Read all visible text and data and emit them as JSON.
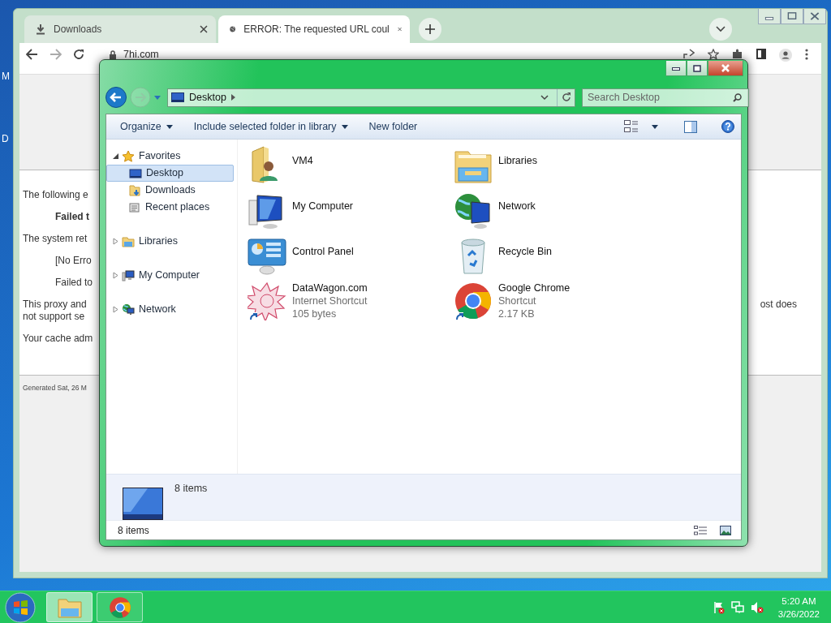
{
  "desktop": {
    "labels": [
      "M",
      "D"
    ]
  },
  "browser": {
    "tabs": [
      {
        "label": "Downloads",
        "selected": false
      },
      {
        "label": "ERROR: The requested URL coul",
        "selected": true
      }
    ],
    "address": "7hi.com",
    "page": {
      "lines": [
        {
          "kind": "text",
          "text": "The following e"
        },
        {
          "kind": "bold",
          "text": "Failed t"
        },
        {
          "kind": "text",
          "text": "The system ret"
        },
        {
          "kind": "indent",
          "text": "[No Erro"
        },
        {
          "kind": "indent",
          "text": "Failed to"
        },
        {
          "kind": "para",
          "text": "This proxy and",
          "right": "ost does",
          "next": "not support se"
        },
        {
          "kind": "text",
          "text": "Your cache adm"
        }
      ],
      "footer": "Generated Sat, 26 M"
    }
  },
  "explorer": {
    "address": "Desktop",
    "search": {
      "placeholder": "Search Desktop"
    },
    "toolbar": [
      {
        "label": "Organize",
        "dropdown": true
      },
      {
        "label": "Include selected folder in library",
        "dropdown": true
      },
      {
        "label": "New folder",
        "dropdown": false
      }
    ],
    "nav": [
      {
        "label": "Favorites",
        "expanded": true,
        "selected": false,
        "children": [
          {
            "label": "Desktop",
            "selected": true
          },
          {
            "label": "Downloads",
            "selected": false
          },
          {
            "label": "Recent places",
            "selected": false
          }
        ]
      },
      {
        "label": "Libraries",
        "expanded": false,
        "selected": false
      },
      {
        "label": "My Computer",
        "expanded": false,
        "selected": false
      },
      {
        "label": "Network",
        "expanded": false,
        "selected": false
      }
    ],
    "items": [
      {
        "name": "VM4"
      },
      {
        "name": "Libraries"
      },
      {
        "name": "My Computer"
      },
      {
        "name": "Network"
      },
      {
        "name": "Control Panel"
      },
      {
        "name": "Recycle Bin"
      },
      {
        "name": "DataWagon.com",
        "type": "Internet Shortcut",
        "size": "105 bytes",
        "shortcut": true
      },
      {
        "name": "Google Chrome",
        "type": "Shortcut",
        "size": "2.17 KB",
        "shortcut": true
      }
    ],
    "details": "8 items",
    "status_bar": "8 items"
  },
  "taskbar": {
    "clock": {
      "time": "5:20 AM",
      "date": "3/26/2022"
    }
  }
}
